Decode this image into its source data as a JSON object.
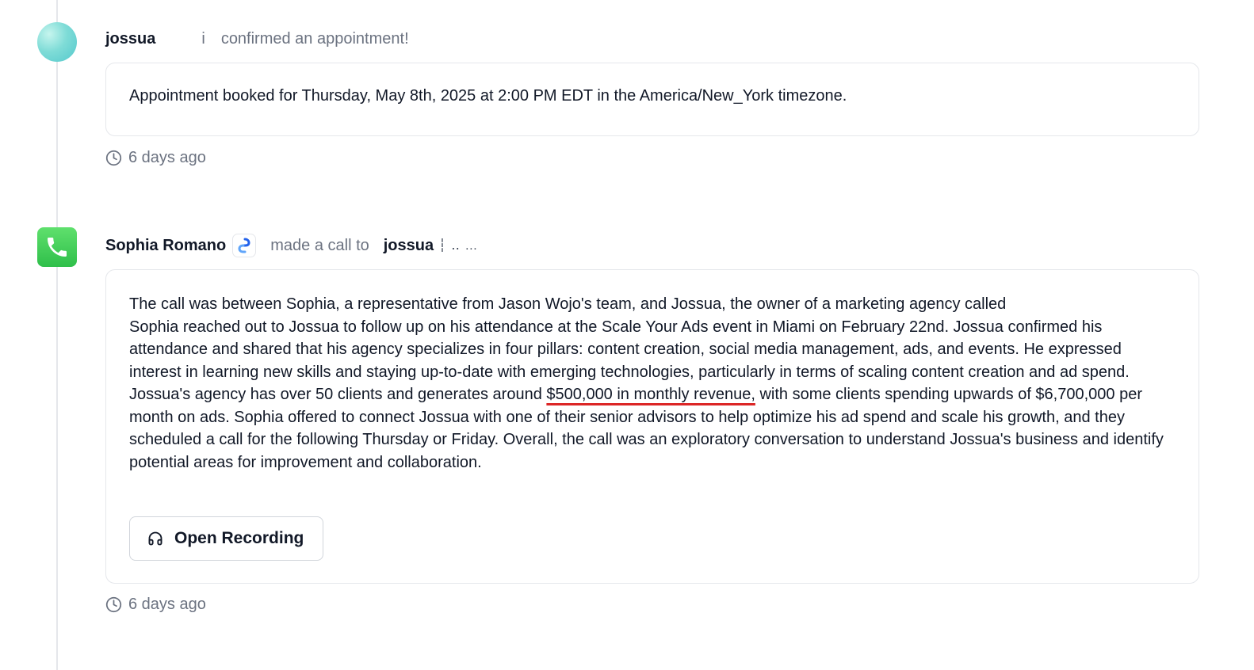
{
  "activities": [
    {
      "actor": "jossua",
      "actor_suffix": "i",
      "action": "confirmed an appointment!",
      "content": "Appointment booked for Thursday, May 8th, 2025 at 2:00 PM EDT in the America/New_York timezone.",
      "time": "6 days ago",
      "icon": "gradient-avatar"
    },
    {
      "actor": "Sophia Romano",
      "action": "made a call to",
      "target": "jossua",
      "target_suffix": "┆ ‥ …",
      "summary_line1": "The call was between Sophia, a representative from Jason Wojo's team, and Jossua, the owner of a marketing agency called",
      "summary_part2": "Sophia reached out to Jossua to follow up on his attendance at the Scale Your Ads event in Miami on February 22nd. Jossua confirmed his attendance and shared that his agency specializes in four pillars: content creation, social media management, ads, and events. He expressed interest in learning new skills and staying up-to-date with emerging technologies, particularly in terms of scaling content creation and ad spend. Jossua's agency has over 50 clients and generates around",
      "summary_highlight": "$500,000 in monthly revenue,",
      "summary_part3": "with some clients spending upwards of $6,700,000 per month on ads. Sophia offered to connect Jossua with one of their senior advisors to help optimize his ad spend and scale his growth, and they scheduled a call for the following Thursday or Friday. Overall, the call was an exploratory conversation to understand Jossua's business and identify potential areas for improvement and collaboration.",
      "button_label": "Open Recording",
      "time": "6 days ago",
      "icon": "phone-icon"
    }
  ],
  "colors": {
    "phone_green": "#34c759",
    "underline_red": "#dc2626",
    "muted_text": "#6b7280",
    "border": "#e5e7eb"
  }
}
